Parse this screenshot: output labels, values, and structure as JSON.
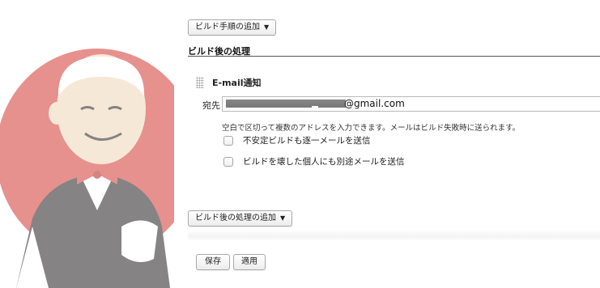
{
  "buttons": {
    "add_build_step": "ビルド手順の追加",
    "add_post_build": "ビルド後の処理の追加",
    "save": "保存",
    "apply": "適用",
    "dropdown_caret": "▼"
  },
  "post_build": {
    "section_title": "ビルド後の処理",
    "plugin_title": "E-mail通知",
    "recipients_label": "宛先",
    "recipients_value": "@gmail.com",
    "help_text": "空白で区切って複数のアドレスを入力できます。メールはビルド失敗時に送られます。",
    "checkbox_unstable_label": "不安定ビルドも逐一メールを送信",
    "checkbox_broken_label": "ビルドを壊した個人にも別途メールを送信",
    "checkbox_unstable_checked": false,
    "checkbox_broken_checked": false
  },
  "icons": {
    "logo": "jenkins-butler-icon",
    "drag_handle": "drag-handle-icon"
  },
  "colors": {
    "logo_red": "#d33833",
    "section_rule": "#555555",
    "redaction": "#808080"
  }
}
